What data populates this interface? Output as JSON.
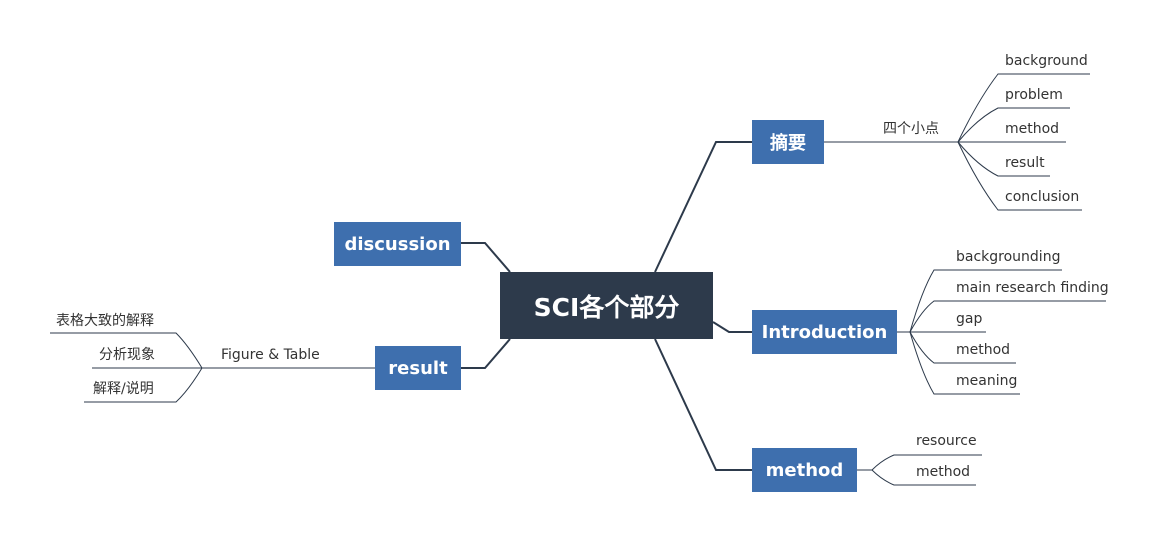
{
  "central": {
    "label": "SCI各个部分"
  },
  "branches": {
    "abstract": {
      "label": "摘要",
      "sub": "四个小点",
      "leaves": [
        "background",
        "problem",
        "method",
        "result",
        "conclusion"
      ]
    },
    "introduction": {
      "label": "Introduction",
      "leaves": [
        "backgrounding",
        "main research finding",
        "gap",
        "method",
        "meaning"
      ]
    },
    "method": {
      "label": "method",
      "leaves": [
        "resource",
        "method"
      ]
    },
    "discussion": {
      "label": "discussion"
    },
    "result": {
      "label": "result",
      "sub": "Figure & Table",
      "leaves": [
        "表格大致的解释",
        "分析现象",
        "解释/说明"
      ]
    }
  },
  "colors": {
    "central": "#2d3a4b",
    "main": "#3e6fae",
    "line": "#2d3a4b",
    "text": "#333333"
  }
}
